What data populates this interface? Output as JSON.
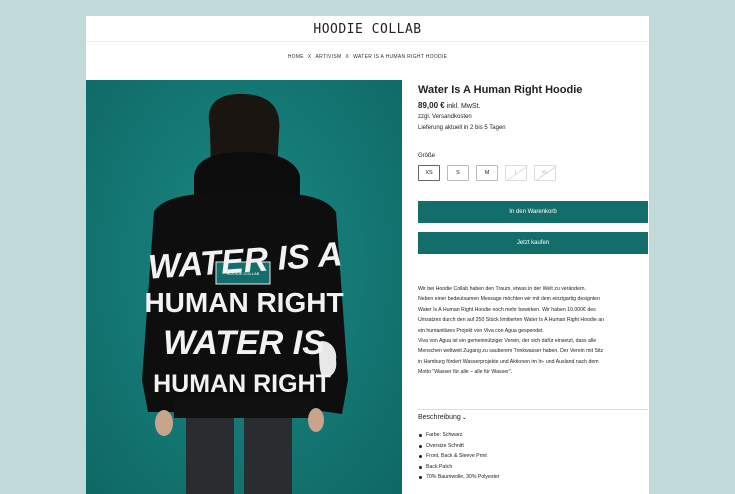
{
  "header": {
    "logo": "HOODIE COLLAB"
  },
  "breadcrumb": [
    "HOME",
    "ARTIVISM",
    "WATER IS A HUMAN RIGHT HOODIE"
  ],
  "breadcrumb_separator": "X",
  "image": {
    "hoodie_lines": [
      "WATER IS A",
      "HUMAN RIGHT",
      "WATER IS",
      "HUMAN RIGHT"
    ],
    "patch_label": "HOODIE COLLAB",
    "background_color": "#157a76"
  },
  "product": {
    "title": "Water Is A Human Right Hoodie",
    "price": "89,00 €",
    "tax_note": "inkl. MwSt.",
    "shipping": "zzgl. Versandkosten",
    "delivery": "Lieferung aktuell in 2 bis 5 Tagen",
    "size_label": "Größe",
    "sizes": [
      {
        "label": "XS",
        "state": "selected"
      },
      {
        "label": "S",
        "state": "available"
      },
      {
        "label": "M",
        "state": "available"
      },
      {
        "label": "L",
        "state": "unavailable"
      },
      {
        "label": "XL",
        "state": "unavailable"
      }
    ],
    "add_to_cart_label": "In den Warenkorb",
    "buy_now_label": "Jetzt kaufen",
    "accent_color": "#136e6b"
  },
  "description": [
    "Wir bei Hoodie Collab haben den Traum, etwas in der Welt zu verändern.",
    "Neben einer bedeutsamen Message möchten wir mit dem einzigartig designten",
    "Water Is A Human Right Hoodie noch mehr bewirken. Wir haben 10.000€ des",
    "Umsatzes durch den auf 250 Stück limitierten Water Is A Human Right Hoodie an",
    "ein humanitäres Projekt von Viva con Agua gespendet.",
    "Viva von Agua ist ein gemeinnütziger Verein, der sich dafür einsetzt, dass alle",
    "Menschen weltweit Zugang zu sauberem Trinkwasser haben. Der Verein mit Sitz",
    "in Hamburg fördert Wasserprojekte und Aktionen im In- und Ausland nach dem",
    "Motto \"Wasser für alle – alle für Wasser\"."
  ],
  "details": {
    "title": "Beschreibung",
    "icon": "chevron-down-icon",
    "items": [
      "Farbe: Schwarz",
      "Oversize Schnitt",
      "Front, Back & Sleeve Print",
      "Back Patch",
      "70% Baumwolle, 30% Polyester"
    ]
  }
}
